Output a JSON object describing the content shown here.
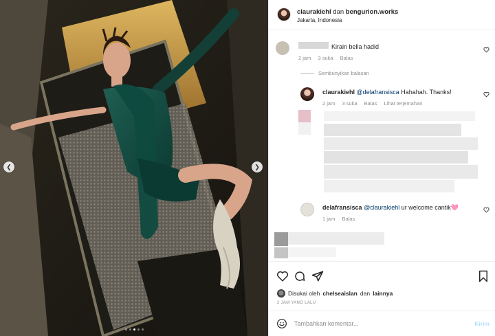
{
  "header": {
    "username": "claurakiehl",
    "connector": "dan",
    "collaborator": "bengurion.works",
    "location": "Jakarta, Indonesia"
  },
  "comments": [
    {
      "text": "Kirain bella hadid",
      "time": "2 jam",
      "likes": "3 suka",
      "reply": "Balas"
    }
  ],
  "hide_replies": "Sembunyikan balasan",
  "replies": [
    {
      "username": "claurakiehl",
      "mention": "@delafransisca",
      "text": "Hahahah. Thanks!",
      "time": "2 jam",
      "likes": "3 suka",
      "reply": "Balas",
      "translate": "Lihat terjemahan"
    },
    {
      "username": "delafransisca",
      "mention": "@claurakiehl",
      "text": "ur welcome cantik🩷",
      "time": "1 jam",
      "reply": "Balas"
    }
  ],
  "likes": {
    "prefix": "Disukai oleh",
    "user": "chelseaislan",
    "connector": "dan",
    "others": "lainnya"
  },
  "timestamp": "2 JAM YANG LALU",
  "input": {
    "placeholder": "Tambahkan komentar...",
    "post_label": "Kirim"
  },
  "carousel": {
    "slides": 5,
    "active": 2
  },
  "colors": {
    "link": "#00376b",
    "muted": "#8e8e8e",
    "post_disabled": "#b2dffc"
  }
}
